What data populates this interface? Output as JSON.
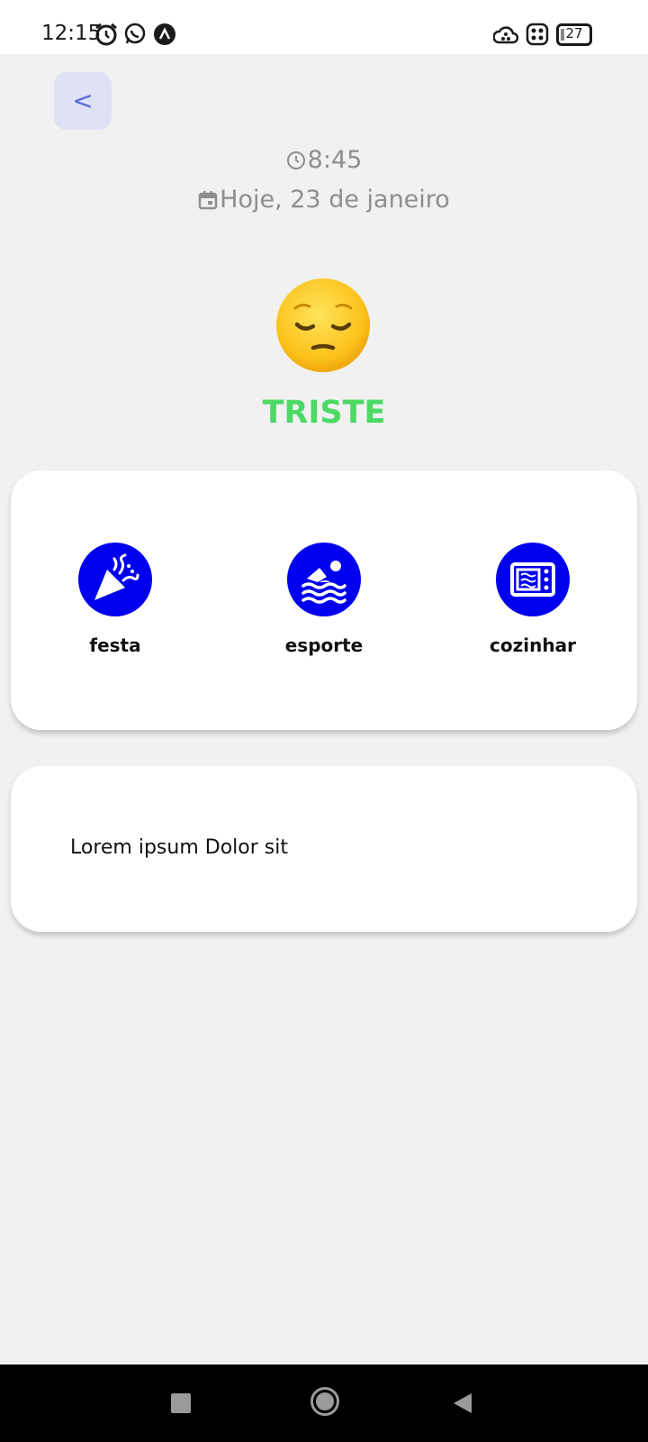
{
  "status_bar": {
    "time": "12:15",
    "battery": "27",
    "icons": [
      "alarm-icon",
      "whatsapp-icon",
      "app-notification-icon",
      "cloud-icon",
      "grid-icon",
      "battery-icon"
    ]
  },
  "header": {
    "back_label": "<",
    "time": "8:45",
    "date": "Hoje, 23 de janeiro"
  },
  "mood": {
    "emoji": "pensive-face-icon",
    "label": "TRISTE",
    "color": "#4cd964"
  },
  "activities": [
    {
      "label": "festa",
      "icon": "party-popper-icon"
    },
    {
      "label": "esporte",
      "icon": "swimming-icon"
    },
    {
      "label": "cozinhar",
      "icon": "microwave-icon"
    }
  ],
  "note": {
    "text": "Lorem ipsum Dolor sit"
  },
  "colors": {
    "accent": "#0000ee",
    "back_button_bg": "#dfe1f5",
    "back_button_fg": "#5a6ad8",
    "background": "#f1f1f1"
  },
  "nav_bar": {
    "icons": [
      "recents-icon",
      "home-icon",
      "back-icon"
    ]
  }
}
